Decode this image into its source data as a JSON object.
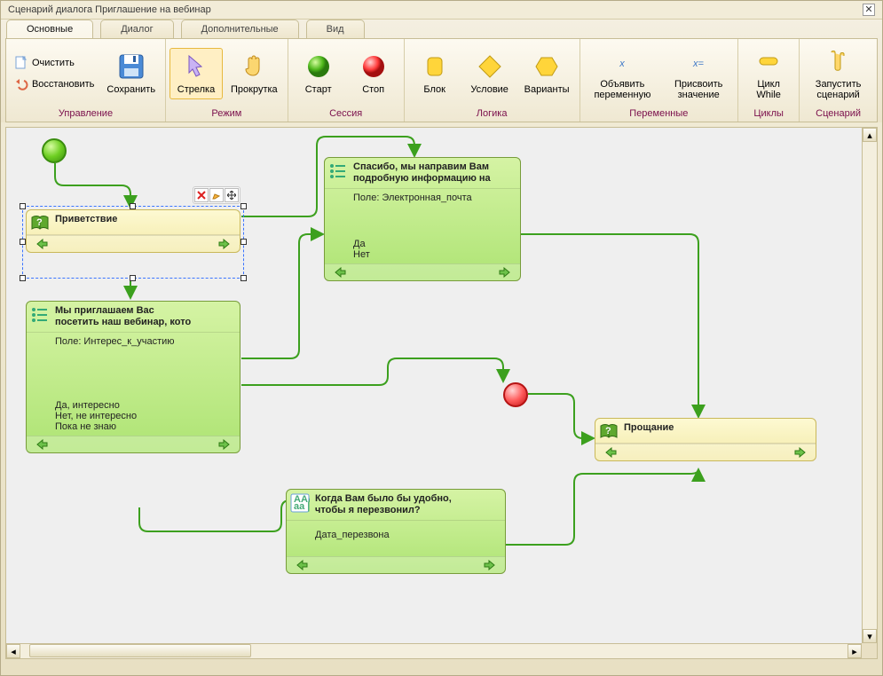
{
  "title": "Сценарий диалога Приглашение на вебинар",
  "tabs": {
    "t0": "Основные",
    "t1": "Диалог",
    "t2": "Дополнительные",
    "t3": "Вид"
  },
  "ribbon": {
    "manage": {
      "label": "Управление",
      "clear": "Очистить",
      "restore": "Восстановить",
      "save": "Сохранить"
    },
    "mode": {
      "label": "Режим",
      "arrow": "Стрелка",
      "scroll": "Прокрутка"
    },
    "session": {
      "label": "Сессия",
      "start": "Старт",
      "stop": "Стоп"
    },
    "logic": {
      "label": "Логика",
      "block": "Блок",
      "cond": "Условие",
      "variants": "Варианты"
    },
    "vars": {
      "label": "Переменные",
      "declare": "Объявить переменную",
      "assign": "Присвоить значение"
    },
    "loops": {
      "label": "Циклы",
      "while": "Цикл While"
    },
    "scenario": {
      "label": "Сценарий",
      "run": "Запустить сценарий"
    }
  },
  "nodes": {
    "greeting": {
      "title": "Приветствие"
    },
    "invite": {
      "title1": "Мы приглашаем Вас",
      "title2": "посетить наш вебинар, кото",
      "field": "Поле: Интерес_к_участию",
      "o1": "Да, интересно",
      "o2": "Нет, не интересно",
      "o3": "Пока не знаю"
    },
    "thanks": {
      "title1": "Спасибо, мы направим Вам",
      "title2": "подробную информацию на",
      "field": "Поле: Электронная_почта",
      "o1": "Да",
      "o2": "Нет"
    },
    "callback": {
      "title1": "Когда Вам было бы удобно,",
      "title2": "чтобы я перезвонил?",
      "field": "Дата_перезвона"
    },
    "farewell": {
      "title": "Прощание"
    }
  }
}
